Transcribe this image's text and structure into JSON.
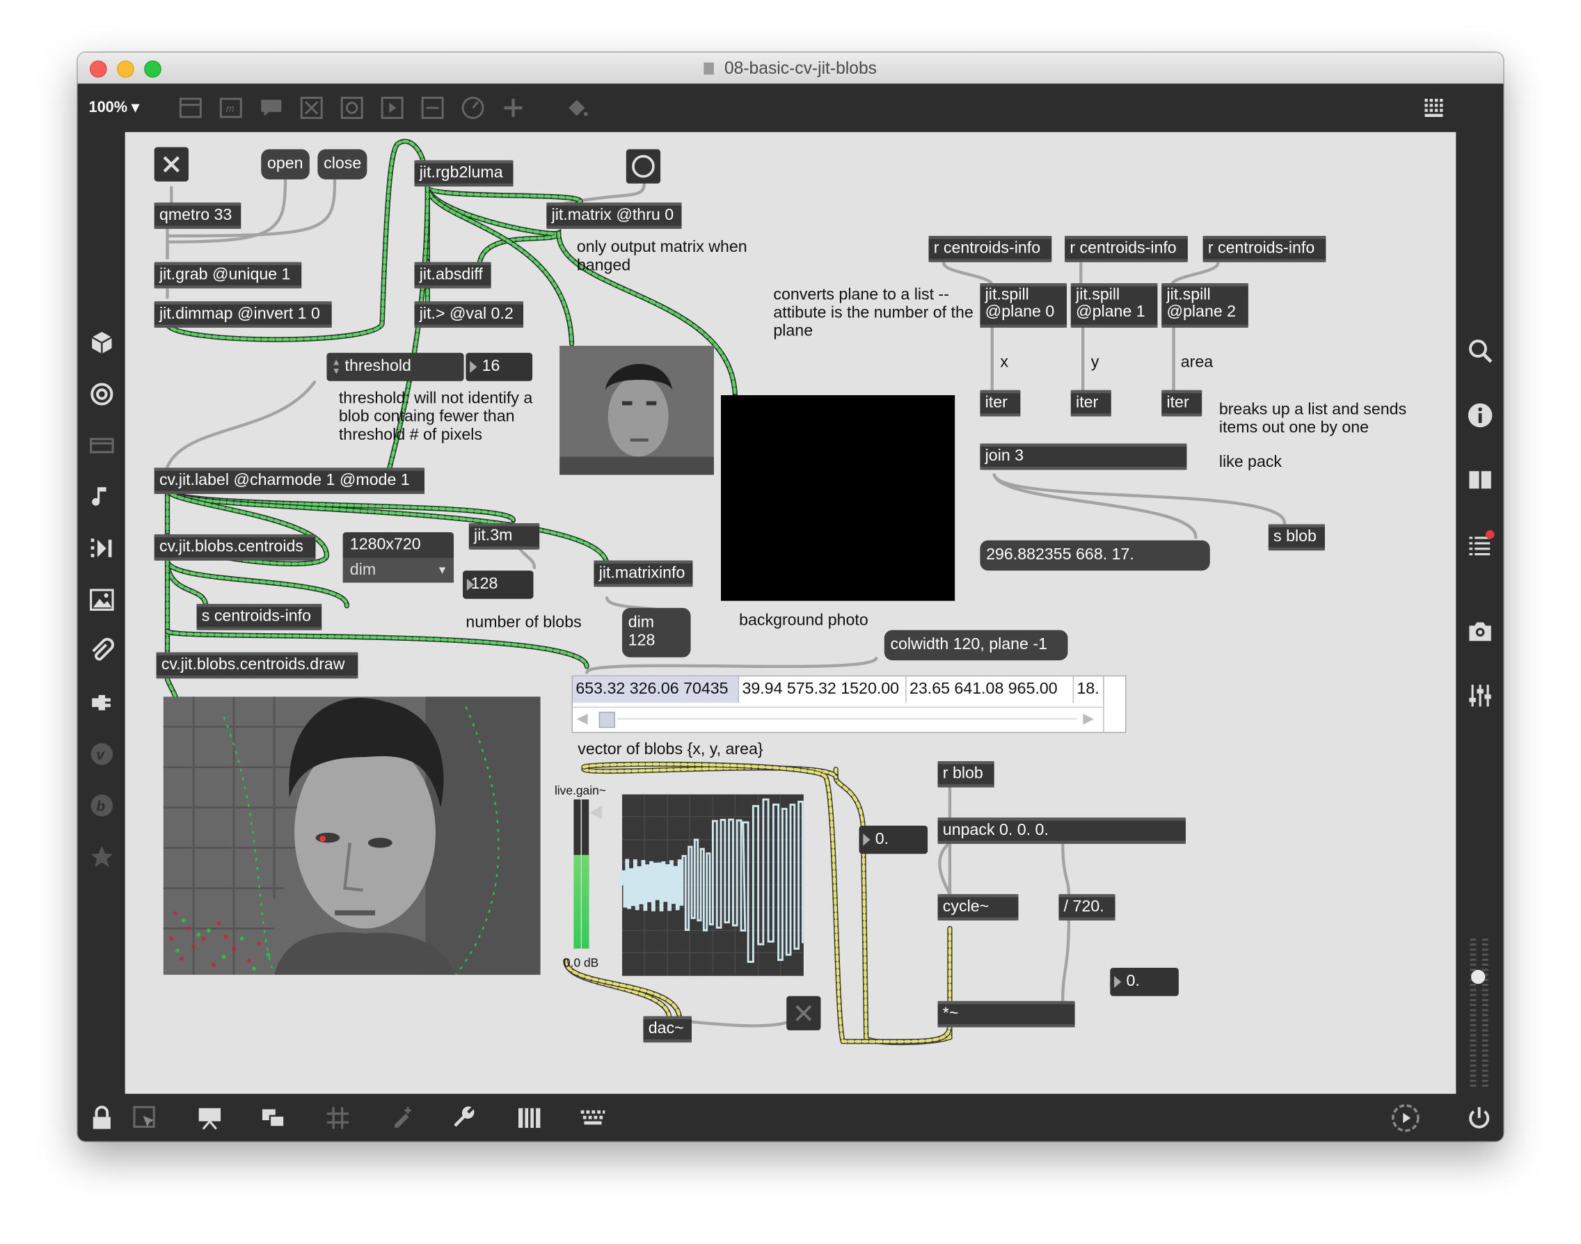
{
  "window": {
    "title": "08-basic-cv-jit-blobs"
  },
  "toolbar": {
    "zoom": "100%"
  },
  "objects": {
    "qmetro": "qmetro 33",
    "grab": "jit.grab @unique 1",
    "dimmap": "jit.dimmap @invert 1 0",
    "rgb2luma": "jit.rgb2luma",
    "matrix_thru": "jit.matrix @thru 0",
    "absdiff": "jit.absdiff",
    "gt": "jit.> @val 0.2",
    "label": "cv.jit.label @charmode 1 @mode 1",
    "centroids": "cv.jit.blobs.centroids",
    "s_centroids": "s centroids-info",
    "centroids_draw": "cv.jit.blobs.centroids.draw",
    "jit3m": "jit.3m",
    "matrixinfo": "jit.matrixinfo",
    "r_centroids_1": "r centroids-info",
    "r_centroids_2": "r centroids-info",
    "r_centroids_3": "r centroids-info",
    "spill0_l1": "jit.spill",
    "spill0_l2": "@plane 0",
    "spill1_l1": "jit.spill",
    "spill1_l2": "@plane 1",
    "spill2_l1": "jit.spill",
    "spill2_l2": "@plane 2",
    "iter1": "iter",
    "iter2": "iter",
    "iter3": "iter",
    "join": "join 3",
    "s_blob": "s blob",
    "r_blob": "r blob",
    "unpack": "unpack 0. 0. 0.",
    "cycle": "cycle~",
    "div": "/ 720.",
    "mul": "*~",
    "dac": "dac~",
    "live_gain": "live.gain~",
    "live_gain_db": "0.0 dB"
  },
  "messages": {
    "open": "open",
    "close": "close",
    "join_out": "296.882355 668. 17.",
    "colwidth": "colwidth 120, plane -1",
    "dim": "dim",
    "dim_val": "128",
    "res": "1280x720",
    "res_menu": "dim"
  },
  "numbers": {
    "threshold_label": "threshold",
    "threshold_value": "16",
    "blob_count": "128",
    "float1": "0.",
    "float2": "0."
  },
  "comments": {
    "only_output": "only output matrix when banged",
    "threshold_note": "threshold: will not identify a blob containg fewer than threshold # of pixels",
    "converts": "converts plane to a list -- attibute is the number of the plane",
    "x": "x",
    "y": "y",
    "area": "area",
    "breaks": "breaks up a list and sends items out one by one",
    "like_pack": "like pack",
    "number_of_blobs": "number of blobs",
    "background_photo": "background photo",
    "vector": "vector of blobs {x, y, area}"
  },
  "cellblock": {
    "cells": [
      "653.32 326.06 70435",
      "39.94 575.32 1520.00",
      "23.65 641.08 965.00",
      "18."
    ]
  },
  "colors": {
    "accent_green": "#33cc55",
    "patch_bg": "#e2e2e2",
    "object_bg": "#373737"
  },
  "sidebar_left_icons": [
    "cube-icon",
    "target-icon",
    "layout-icon",
    "music-note-icon",
    "step-icon",
    "image-icon",
    "paperclip-icon",
    "plug-icon",
    "v-icon",
    "b-icon",
    "star-icon"
  ],
  "sidebar_right_icons": [
    "search-icon",
    "info-icon",
    "split-view-icon",
    "list-icon",
    "camera-icon",
    "mixer-icon"
  ],
  "bottombar_icons": [
    "lock-icon",
    "select-icon",
    "presentation-icon",
    "windows-icon",
    "grid-icon",
    "snap-icon",
    "wrench-icon",
    "piano-icon",
    "keyboard-icon",
    "transport-icon",
    "power-icon"
  ]
}
